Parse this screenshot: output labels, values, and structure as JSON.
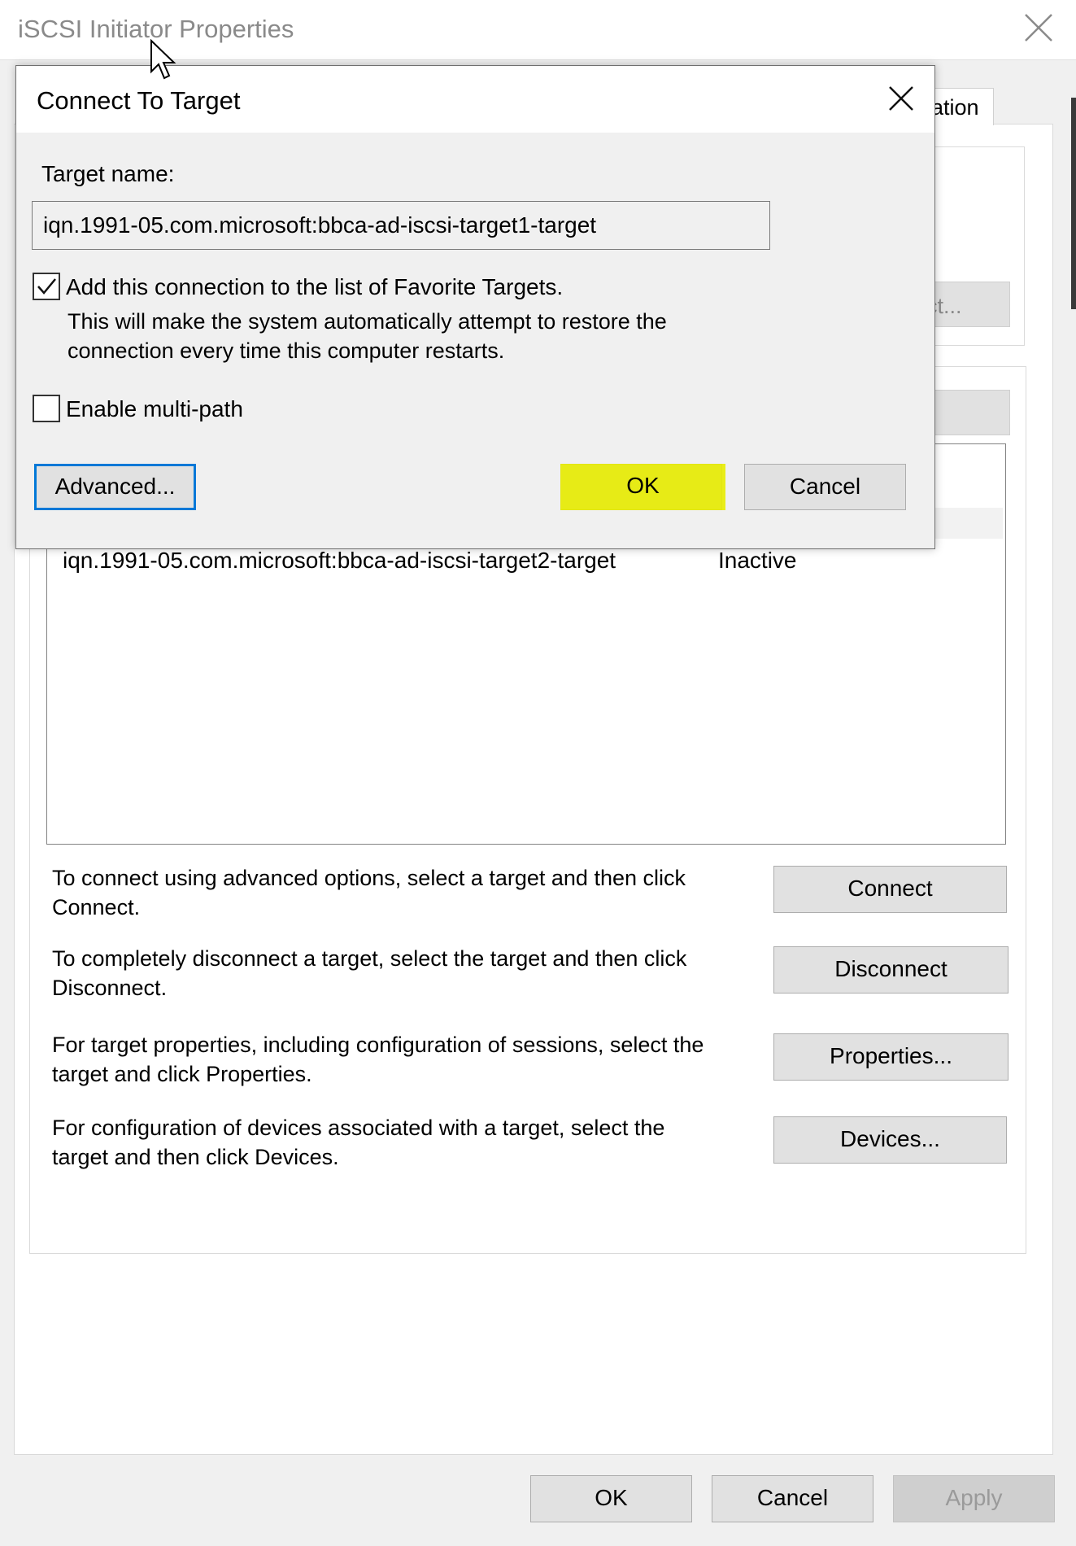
{
  "window": {
    "title": "iSCSI Initiator Properties",
    "tab_fragment": "ation",
    "partial_button_label": "ct..."
  },
  "targets_list": {
    "rows": [
      {
        "name": "iqn.1991-05.com.microsoft:bbca-ad-iscsi-target2-target",
        "status": "Inactive"
      }
    ]
  },
  "actions": [
    {
      "description": "To connect using advanced options, select a target and then click Connect.",
      "button": "Connect"
    },
    {
      "description": "To completely disconnect a target, select the target and then click Disconnect.",
      "button": "Disconnect"
    },
    {
      "description": "For target properties, including configuration of sessions, select the target and click Properties.",
      "button": "Properties..."
    },
    {
      "description": "For configuration of devices associated with a target, select the target and then click Devices.",
      "button": "Devices..."
    }
  ],
  "footer": {
    "ok": "OK",
    "cancel": "Cancel",
    "apply": "Apply"
  },
  "dialog": {
    "title": "Connect To Target",
    "target_name_label": "Target name:",
    "target_name_value": "iqn.1991-05.com.microsoft:bbca-ad-iscsi-target1-target",
    "favorite_checkbox_label": "Add this connection to the list of Favorite Targets.",
    "favorite_checkbox_checked": true,
    "favorite_description_line1": "This will make the system automatically attempt to restore the",
    "favorite_description_line2": "connection every time this computer restarts.",
    "multipath_checkbox_label": "Enable multi-path",
    "multipath_checkbox_checked": false,
    "advanced_button": "Advanced...",
    "ok_button": "OK",
    "cancel_button": "Cancel"
  },
  "colors": {
    "highlight": "#e8ec00",
    "focus_border": "#0078d7"
  }
}
